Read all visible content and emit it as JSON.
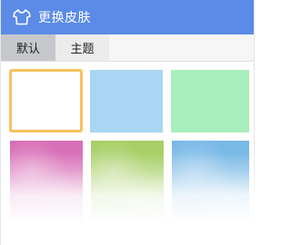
{
  "window": {
    "title": "更换皮肤",
    "icon": "tshirt-icon",
    "accent_color": "#5b8be6"
  },
  "tabs": [
    {
      "label": "默认",
      "selected": true
    },
    {
      "label": "主题",
      "selected": false
    }
  ],
  "swatches": [
    {
      "name": "white",
      "color": "#ffffff",
      "selected": true
    },
    {
      "name": "light-blue",
      "color": "#a8d6f3",
      "selected": false
    },
    {
      "name": "light-green",
      "color": "#a9efbd",
      "selected": false
    },
    {
      "name": "pink-magenta",
      "color": "#d870b8",
      "selected": false
    },
    {
      "name": "lime-green",
      "color": "#a7cf66",
      "selected": false
    },
    {
      "name": "sky-blue",
      "color": "#79b9e6",
      "selected": false
    }
  ]
}
